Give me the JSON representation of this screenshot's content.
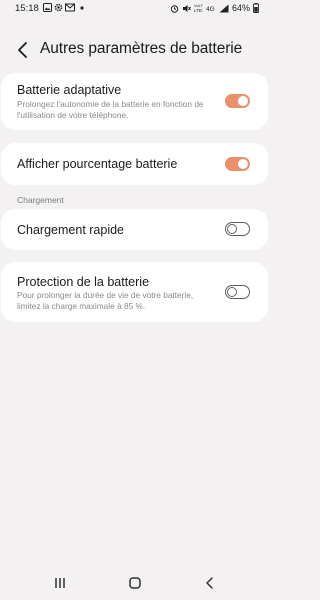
{
  "status_bar": {
    "time": "15:18",
    "battery_percent": "64%",
    "icons": [
      "gallery-icon",
      "gear-icon",
      "mail-icon",
      "dot-icon",
      "alarm-icon",
      "mute-icon",
      "lte-signal-icon",
      "4g-icon",
      "signal-icon",
      "battery-icon"
    ]
  },
  "header": {
    "title": "Autres paramètres de batterie",
    "back_icon": "back-arrow-icon"
  },
  "settings": {
    "adaptive_battery": {
      "title": "Batterie adaptative",
      "description": "Prolongez l'autonomie de la batterie en fonction de l'utilisation de votre téléphone.",
      "enabled": true
    },
    "show_percentage": {
      "title": "Afficher pourcentage batterie",
      "enabled": true
    },
    "charging_section_label": "Chargement",
    "fast_charging": {
      "title": "Chargement rapide",
      "enabled": false
    },
    "battery_protection": {
      "title": "Protection de la batterie",
      "description": "Pour prolonger la durée de vie de votre batterie, limitez la charge maximale à 85 %.",
      "enabled": false
    }
  },
  "colors": {
    "accent": "#e8916a",
    "background": "#f3f1f2",
    "card": "#ffffff",
    "switch_off": "#5f5f5f"
  },
  "nav_bar": {
    "icons": [
      "recents-icon",
      "home-icon",
      "back-icon"
    ]
  }
}
